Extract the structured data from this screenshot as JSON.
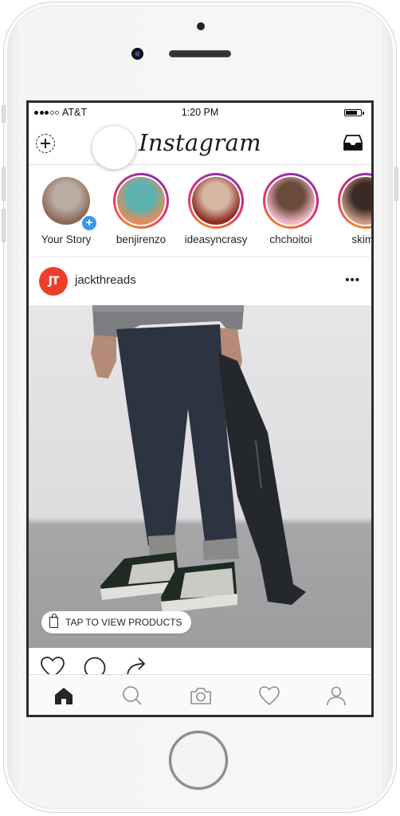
{
  "device": {
    "model": "iPhone",
    "color": "silver"
  },
  "status_bar": {
    "signal_filled": 3,
    "signal_total": 5,
    "carrier": "AT&T",
    "time": "1:20 PM",
    "battery_level": 0.8
  },
  "nav_bar": {
    "title": "Instagram",
    "left_icon": "new-story-icon",
    "right_icon": "inbox-icon"
  },
  "stories": [
    {
      "username": "Your Story",
      "own": true,
      "has_new": false,
      "avatar_colors": [
        "#8a6a55",
        "#b9aca2"
      ]
    },
    {
      "username": "benjirenzo",
      "own": false,
      "has_new": true,
      "avatar_colors": [
        "#e38a5c",
        "#5ab3b0"
      ]
    },
    {
      "username": "ideasyncrasy",
      "own": false,
      "has_new": true,
      "avatar_colors": [
        "#8e2b22",
        "#d7b7a3"
      ]
    },
    {
      "username": "chchoitoi",
      "own": false,
      "has_new": true,
      "avatar_colors": [
        "#f0b6c6",
        "#6a4a3a"
      ]
    },
    {
      "username": "skimo",
      "own": false,
      "has_new": true,
      "avatar_colors": [
        "#c79a86",
        "#3a2a24"
      ]
    }
  ],
  "post": {
    "username": "jackthreads",
    "avatar_initials": "JT",
    "avatar_color": "#ec3f2a",
    "more_label": "•••",
    "shopping_tag": "TAP TO VIEW PRODUCTS",
    "actions": [
      "like-icon",
      "comment-icon",
      "share-icon"
    ]
  },
  "tab_bar": {
    "items": [
      {
        "name": "home",
        "active": true
      },
      {
        "name": "search",
        "active": false
      },
      {
        "name": "camera",
        "active": false
      },
      {
        "name": "activity",
        "active": false
      },
      {
        "name": "profile",
        "active": false
      }
    ]
  }
}
